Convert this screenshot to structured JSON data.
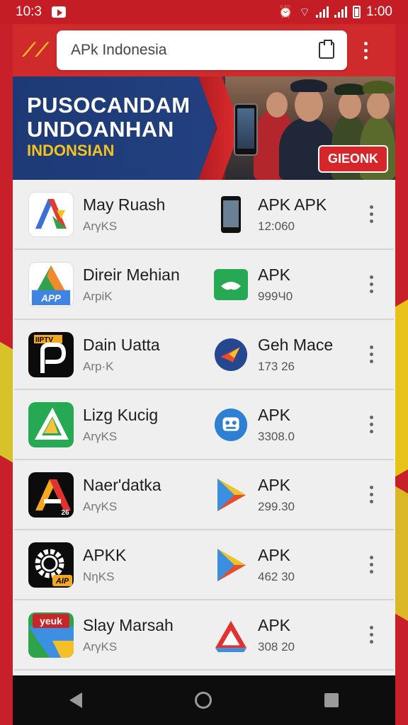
{
  "status_bar": {
    "time": "10:3",
    "battery_time": "1:00",
    "icons": [
      "play-box-icon",
      "alarm-icon",
      "wifi-icon",
      "signal-icon",
      "battery-icon"
    ]
  },
  "app_bar": {
    "search_text": "APk Indonesia",
    "icons": [
      "logo-icon",
      "clipboard-icon",
      "overflow-menu-icon"
    ],
    "accent": "#cf2a2c"
  },
  "banner": {
    "title_line1": "PUSOCANDAM",
    "title_line2": "UNDOANHAN",
    "subtitle": "INDONSIAN",
    "button_label": "GIEONK"
  },
  "apps": [
    {
      "left_name": "May Ruash",
      "left_sub": "ArγKS",
      "right_name": "APK APK",
      "right_sub": "12:060",
      "left_icon": "maps-like-icon",
      "right_icon": "phone-icon"
    },
    {
      "left_name": "Direir Mehian",
      "left_sub": "ArpiK",
      "left_badge": "APP",
      "right_name": "APK",
      "right_sub": "999Ч0",
      "left_icon": "drive-like-icon",
      "right_icon": "handshake-icon"
    },
    {
      "left_name": "Dain Uatta",
      "left_sub": "Arp·K",
      "left_badge": "IIPTV",
      "right_name": "Geh Mace",
      "right_sub": "173 26",
      "left_icon": "iptv-icon",
      "right_icon": "bird-icon"
    },
    {
      "left_name": "Lizg Kucig",
      "left_sub": "ArγKS",
      "right_name": "APK",
      "right_sub": "3308.0",
      "left_icon": "triangle-app-icon",
      "right_icon": "robot-icon"
    },
    {
      "left_name": "Naer'datka",
      "left_sub": "ArγKS",
      "left_badge": "26",
      "right_name": "APK",
      "right_sub": "299.30",
      "left_icon": "letter-a-icon",
      "right_icon": "play-store-icon"
    },
    {
      "left_name": "APKK",
      "left_sub": "NηKS",
      "left_badge": "AIP",
      "right_name": "APK",
      "right_sub": "462 30",
      "left_icon": "gear-icon",
      "right_icon": "play-store-icon"
    },
    {
      "left_name": "Slay Marsah",
      "left_sub": "ArγKS",
      "left_badge": "yeuk",
      "right_name": "APK",
      "right_sub": "308 20",
      "left_icon": "maps-yeuk-icon",
      "right_icon": "drive-triangle-icon"
    }
  ]
}
